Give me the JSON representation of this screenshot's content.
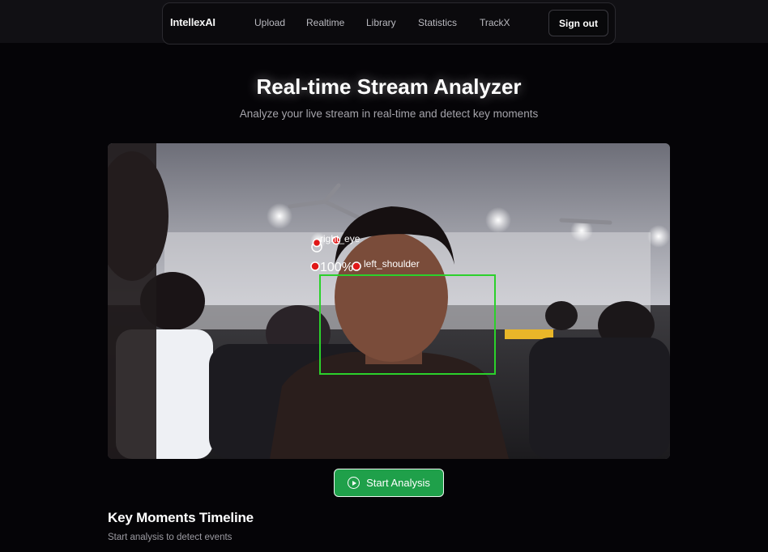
{
  "nav": {
    "brand": "IntellexAI",
    "links": [
      "Upload",
      "Realtime",
      "Library",
      "Statistics",
      "TrackX"
    ],
    "signout_label": "Sign out"
  },
  "header": {
    "title": "Real-time Stream Analyzer",
    "subtitle": "Analyze your live stream in real-time and detect key moments"
  },
  "stream": {
    "labels": {
      "eye": "right_eye",
      "confidence": "100%",
      "shoulder": "left_shoulder"
    },
    "box_color": "#2bd12b",
    "point_color": "#e01818"
  },
  "actions": {
    "start_label": "Start Analysis",
    "start_icon": "play-circle-icon",
    "accent": "#1fa04a"
  },
  "timeline": {
    "title": "Key Moments Timeline",
    "subtitle": "Start analysis to detect events"
  }
}
